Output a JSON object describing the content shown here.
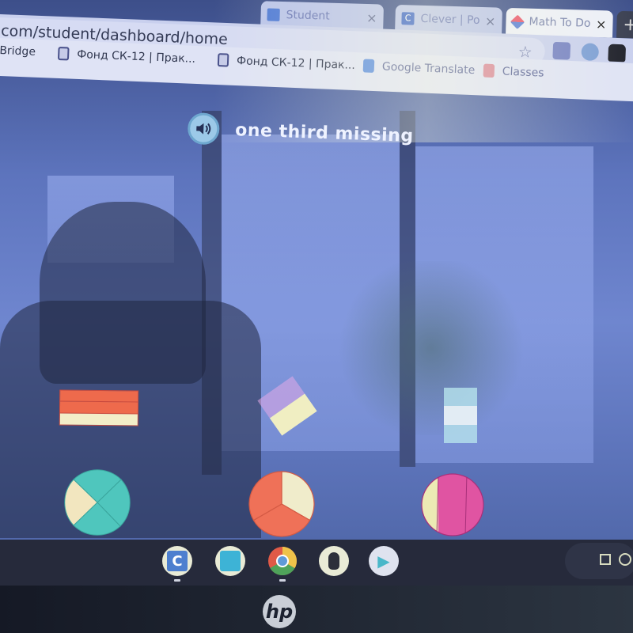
{
  "browser": {
    "tabs": [
      {
        "label": "Student",
        "favicon": "google-classroom-icon",
        "active": false
      },
      {
        "label": "Clever | Po",
        "favicon": "clever-icon",
        "active": false
      },
      {
        "label": "Math To Do",
        "favicon": "math-to-do-cube-icon",
        "active": true
      }
    ],
    "close_glyph": "×",
    "new_tab_glyph": "+",
    "url": "com/student/dashboard/home",
    "star_glyph": "☆",
    "bookmarks": [
      {
        "label": "Bridge"
      },
      {
        "label": "Фонд СК-12 | Прак...",
        "icon": "document-icon"
      },
      {
        "label": "Фонд СК-12 | Прак...",
        "icon": "document-icon"
      },
      {
        "label": "Google Translate",
        "icon": "google-translate-icon"
      },
      {
        "label": "Classes",
        "icon": "classes-icon"
      }
    ]
  },
  "activity": {
    "prompt": "one third missing",
    "audio_button": "speaker-icon",
    "choices_row1": [
      {
        "shape": "horizontal-bar",
        "parts": 3,
        "missing": 1,
        "filled_color": "#ee6a4c",
        "empty_color": "#f3eec8"
      },
      {
        "shape": "diamond",
        "parts": 2,
        "missing": 1,
        "filled_color": "#e3a9e8",
        "empty_color": "#f0eec2"
      },
      {
        "shape": "vertical-rect",
        "parts": 3,
        "missing": 1,
        "filled_color": "#b7e3ec",
        "empty_color": "#eef6f8"
      }
    ],
    "choices_row2": [
      {
        "shape": "circle",
        "parts": 4,
        "missing": 1,
        "filled_color": "#4fc6bd",
        "empty_color": "#f2e6bf"
      },
      {
        "shape": "circle",
        "parts": 3,
        "missing": 1,
        "filled_color": "#ef7158",
        "empty_color": "#f0eccb"
      },
      {
        "shape": "circle",
        "parts": 3,
        "missing": 1,
        "filled_color": "#e054a2",
        "empty_color": "#eceab4"
      }
    ]
  },
  "shelf": {
    "apps": [
      {
        "name": "clever",
        "glyph": "C",
        "running": true
      },
      {
        "name": "pinguino-reading",
        "glyph": "",
        "running": false
      },
      {
        "name": "chrome",
        "glyph": "",
        "running": true
      },
      {
        "name": "penguin-app",
        "glyph": "",
        "running": false
      },
      {
        "name": "play-store",
        "glyph": "▶",
        "running": false
      }
    ]
  },
  "device": {
    "brand": "hp"
  }
}
